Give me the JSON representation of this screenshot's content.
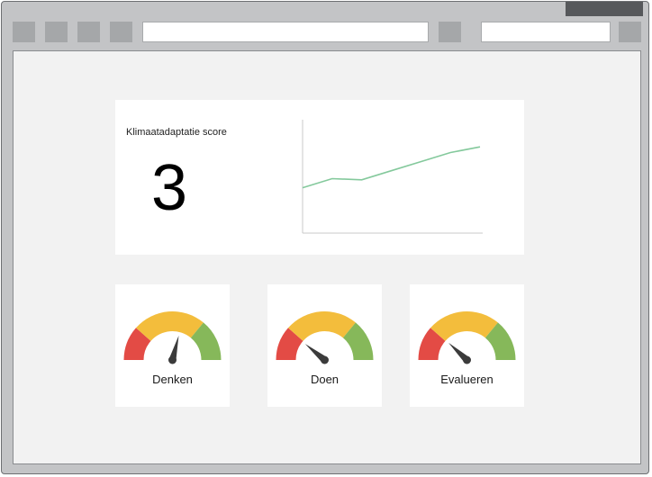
{
  "dashboard": {
    "score_card": {
      "title": "Klimaatadaptatie score",
      "value": "3",
      "trend": {
        "x": [
          0,
          1,
          2,
          3,
          4,
          5,
          6
        ],
        "y": [
          0.4,
          0.48,
          0.47,
          0.55,
          0.63,
          0.71,
          0.76
        ],
        "ylim": [
          0,
          1
        ],
        "color": "#84c99c"
      }
    },
    "gauges": [
      {
        "label": "Denken",
        "level": 0.58
      },
      {
        "label": "Doen",
        "level": 0.22
      },
      {
        "label": "Evalueren",
        "level": 0.24
      }
    ],
    "gauge_colors": {
      "low": "#e34b45",
      "mid": "#f3bd3c",
      "high": "#86b85a",
      "needle": "#3b3b3b"
    }
  }
}
